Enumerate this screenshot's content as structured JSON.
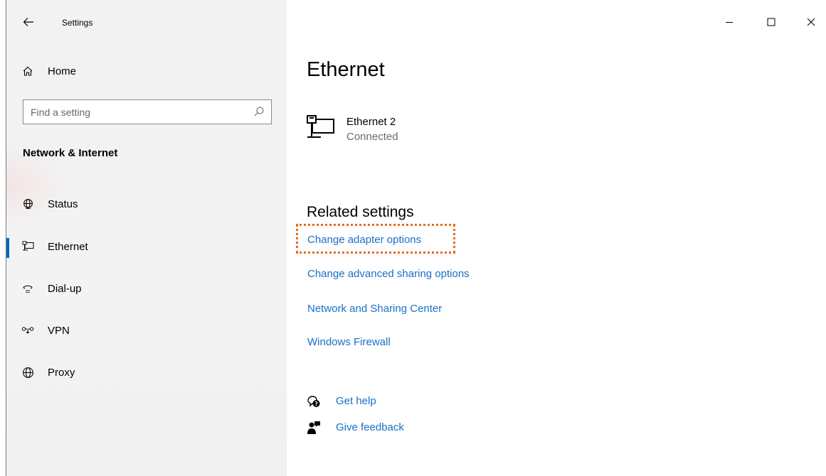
{
  "window": {
    "title": "Settings",
    "controls": [
      "minimize",
      "maximize",
      "close"
    ]
  },
  "sidebar": {
    "home_label": "Home",
    "search": {
      "placeholder": "Find a setting",
      "value": ""
    },
    "section_title": "Network & Internet",
    "items": [
      {
        "label": "Status",
        "icon": "status-globe-icon",
        "selected": false
      },
      {
        "label": "Ethernet",
        "icon": "ethernet-icon",
        "selected": true
      },
      {
        "label": "Dial-up",
        "icon": "dialup-icon",
        "selected": false
      },
      {
        "label": "VPN",
        "icon": "vpn-icon",
        "selected": false
      },
      {
        "label": "Proxy",
        "icon": "proxy-globe-icon",
        "selected": false
      }
    ]
  },
  "main": {
    "title": "Ethernet",
    "network": {
      "name": "Ethernet 2",
      "status": "Connected",
      "icon": "ethernet-network-icon"
    },
    "related_title": "Related settings",
    "related_links": [
      {
        "label": "Change adapter options",
        "highlighted": true
      },
      {
        "label": "Change advanced sharing options",
        "highlighted": false
      },
      {
        "label": "Network and Sharing Center",
        "highlighted": false
      },
      {
        "label": "Windows Firewall",
        "highlighted": false
      }
    ],
    "help": [
      {
        "label": "Get help",
        "icon": "get-help-icon"
      },
      {
        "label": "Give feedback",
        "icon": "give-feedback-icon"
      }
    ]
  },
  "colors": {
    "accent": "#0067c0",
    "link": "#1a6fc5",
    "highlight_border": "#e86a1c",
    "sidebar_bg": "#f2f2f2"
  }
}
